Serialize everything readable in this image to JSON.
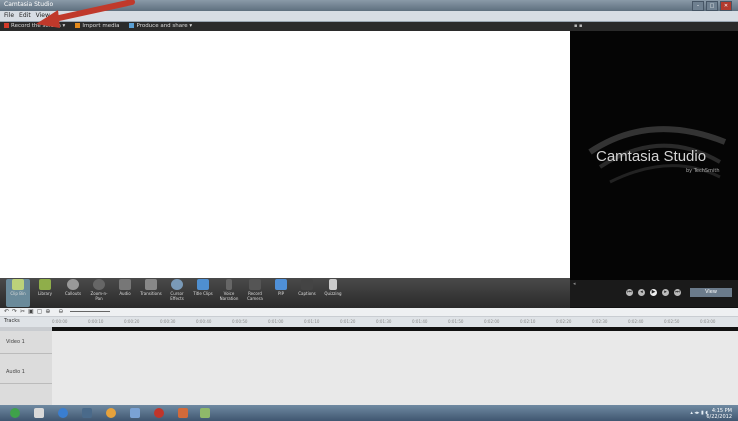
{
  "app": {
    "title": "Camtasia Studio",
    "window_controls": [
      "–",
      "□",
      "✕"
    ]
  },
  "menu": {
    "items": [
      "File",
      "Edit",
      "View",
      "?"
    ]
  },
  "task_strip": {
    "items": [
      {
        "label": "Record the screen ▾",
        "icon": "record-icon"
      },
      {
        "label": "Import media",
        "icon": "import-icon"
      },
      {
        "label": "Produce and share ▾",
        "icon": "produce-icon"
      }
    ]
  },
  "preview": {
    "logo_text": "Camtasia Studio",
    "logo_sub": "by TechSmith",
    "view_button": "View"
  },
  "tools": [
    {
      "label": "Clip Bin",
      "icon": "clip-bin-icon"
    },
    {
      "label": "Library",
      "icon": "library-icon"
    },
    {
      "label": "Callouts",
      "icon": "callouts-icon"
    },
    {
      "label": "Zoom-n-Pan",
      "icon": "zoom-icon"
    },
    {
      "label": "Audio",
      "icon": "audio-icon"
    },
    {
      "label": "Transitions",
      "icon": "transitions-icon"
    },
    {
      "label": "Cursor Effects",
      "icon": "cursor-effects-icon"
    },
    {
      "label": "Title Clips",
      "icon": "title-clips-icon"
    },
    {
      "label": "Voice Narration",
      "icon": "voice-narration-icon"
    },
    {
      "label": "Record Camera",
      "icon": "record-camera-icon"
    },
    {
      "label": "PIP",
      "icon": "pip-icon"
    },
    {
      "label": "Captions",
      "icon": "captions-icon"
    },
    {
      "label": "Quizzing",
      "icon": "quizzing-icon"
    }
  ],
  "timeline": {
    "tracks_label": "Tracks",
    "track1": "Video 1",
    "track2": "Audio 1",
    "ruler": [
      "0:00:00",
      "0:00:10",
      "0:00:20",
      "0:00:30",
      "0:00:40",
      "0:00:50",
      "0:01:00",
      "0:01:10",
      "0:01:20",
      "0:01:30",
      "0:01:40",
      "0:01:50",
      "0:02:00",
      "0:02:10",
      "0:02:20",
      "0:02:30",
      "0:02:40",
      "0:02:50",
      "0:03:00"
    ]
  },
  "taskbar": {
    "clock": "4:15 PM",
    "date": "6/22/2012"
  },
  "colors": {
    "annotation_arrow": "#c0392b",
    "preview_bg": "#050505",
    "toolbar_bg": "#2a2a2a"
  }
}
